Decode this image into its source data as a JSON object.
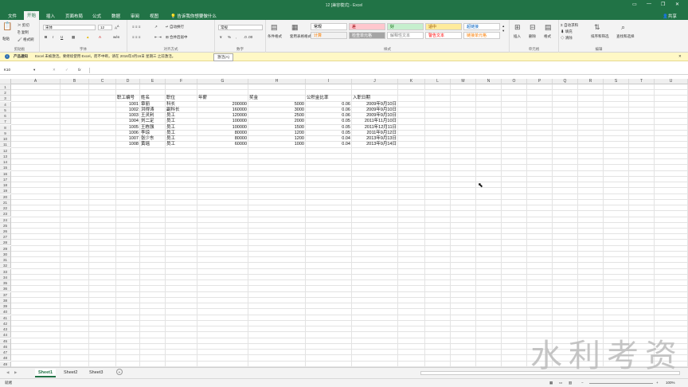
{
  "window": {
    "title": "12 [兼容模式] - Excel",
    "share": "共享",
    "controls": [
      "▭",
      "—",
      "❐",
      "✕"
    ]
  },
  "tabs": [
    "文件",
    "开始",
    "插入",
    "页面布局",
    "公式",
    "数据",
    "审阅",
    "视图"
  ],
  "active_tab": 1,
  "tell_me": "告诉我你想要做什么",
  "ribbon": {
    "clipboard": {
      "label": "剪贴板",
      "paste": "粘贴",
      "cut": "剪切",
      "copy": "复制",
      "painter": "格式刷"
    },
    "font": {
      "label": "字体",
      "name": "宋体",
      "size": "12",
      "bold": "B",
      "italic": "I",
      "underline": "U"
    },
    "align": {
      "label": "对齐方式",
      "wrap": "自动换行",
      "merge": "合并后居中"
    },
    "number": {
      "label": "数字",
      "format": "常规",
      "pct": "%",
      "comma": ","
    },
    "styles": {
      "label": "样式",
      "cond": "条件格式",
      "table": "套用表格格式",
      "cell": "单元格样式",
      "items": [
        {
          "text": "常规",
          "bg": "#ffffff",
          "fg": "#000000"
        },
        {
          "text": "差",
          "bg": "#ffc7ce",
          "fg": "#9c0006"
        },
        {
          "text": "好",
          "bg": "#c6efce",
          "fg": "#006100"
        },
        {
          "text": "适中",
          "bg": "#ffeb9c",
          "fg": "#9c5700"
        },
        {
          "text": "超链接",
          "bg": "#ffffff",
          "fg": "#0563c1"
        },
        {
          "text": "计算",
          "bg": "#f2f2f2",
          "fg": "#fa7d00"
        },
        {
          "text": "检查单元格",
          "bg": "#a5a5a5",
          "fg": "#ffffff"
        },
        {
          "text": "解释性文本",
          "bg": "#ffffff",
          "fg": "#7f7f7f"
        },
        {
          "text": "警告文本",
          "bg": "#ffffff",
          "fg": "#ff0000"
        },
        {
          "text": "链接单元格",
          "bg": "#ffffff",
          "fg": "#fa7d00"
        }
      ]
    },
    "cells": {
      "label": "单元格",
      "insert": "插入",
      "delete": "删除",
      "format": "格式"
    },
    "edit": {
      "label": "编辑",
      "autosum": "自动求和",
      "fill": "填充",
      "clear": "清除",
      "sort": "排序和筛选",
      "find": "查找和选择"
    }
  },
  "infobar": {
    "bold": "产品通知",
    "text": "Excel 未被激活。要继续使用 Excel，而不中断，请在 2016年3月16日 星期三 之前激活。",
    "button": "激活(A)"
  },
  "formula": {
    "name_box": "K10",
    "fx": "fx",
    "value": ""
  },
  "columns": [
    "A",
    "B",
    "C",
    "D",
    "E",
    "F",
    "G",
    "H",
    "I",
    "J",
    "K",
    "L",
    "M",
    "N",
    "O",
    "P",
    "Q",
    "R",
    "S",
    "T",
    "U"
  ],
  "rows": [
    "1",
    "2",
    "3",
    "4",
    "5",
    "6",
    "7",
    "8",
    "9",
    "10",
    "11",
    "12",
    "13",
    "14",
    "15",
    "16",
    "17",
    "18",
    "19",
    "20",
    "21",
    "22",
    "23",
    "24",
    "25",
    "26",
    "27",
    "28",
    "29",
    "30",
    "31",
    "32",
    "33",
    "34",
    "35",
    "36",
    "37",
    "38",
    "39",
    "40",
    "41",
    "42",
    "43",
    "44",
    "45",
    "46",
    "47",
    "48",
    "49"
  ],
  "table": {
    "headers": [
      "职工编号",
      "姓名",
      "职位",
      "年薪",
      "奖金",
      "公积金比率",
      "入职日期"
    ],
    "rows": [
      [
        "1001",
        "章丽",
        "科长",
        "200000",
        "5000",
        "0.06",
        "2009年9月10日"
      ],
      [
        "1002",
        "洪得涛",
        "副科长",
        "160000",
        "3000",
        "0.06",
        "2009年9月10日"
      ],
      [
        "1003",
        "王灵利",
        "员工",
        "120000",
        "2500",
        "0.06",
        "2009年9月10日"
      ],
      [
        "1004",
        "刘二定",
        "员工",
        "100000",
        "2000",
        "0.05",
        "2011年11月10日"
      ],
      [
        "1005",
        "王栋强",
        "员工",
        "100000",
        "1500",
        "0.05",
        "2011年12月11日"
      ],
      [
        "1006",
        "李琼",
        "员工",
        "80000",
        "1200",
        "0.05",
        "2011年9月12日"
      ],
      [
        "1007",
        "张少东",
        "员工",
        "80000",
        "1200",
        "0.04",
        "2013年9月13日"
      ],
      [
        "1008",
        "黄瑶",
        "员工",
        "60000",
        "1000",
        "0.04",
        "2013年9月14日"
      ]
    ]
  },
  "sheets": [
    "Sheet1",
    "Sheet2",
    "Sheet3"
  ],
  "active_sheet": 0,
  "status": {
    "ready": "就绪",
    "zoom": "100%"
  },
  "watermark": "水利考资"
}
